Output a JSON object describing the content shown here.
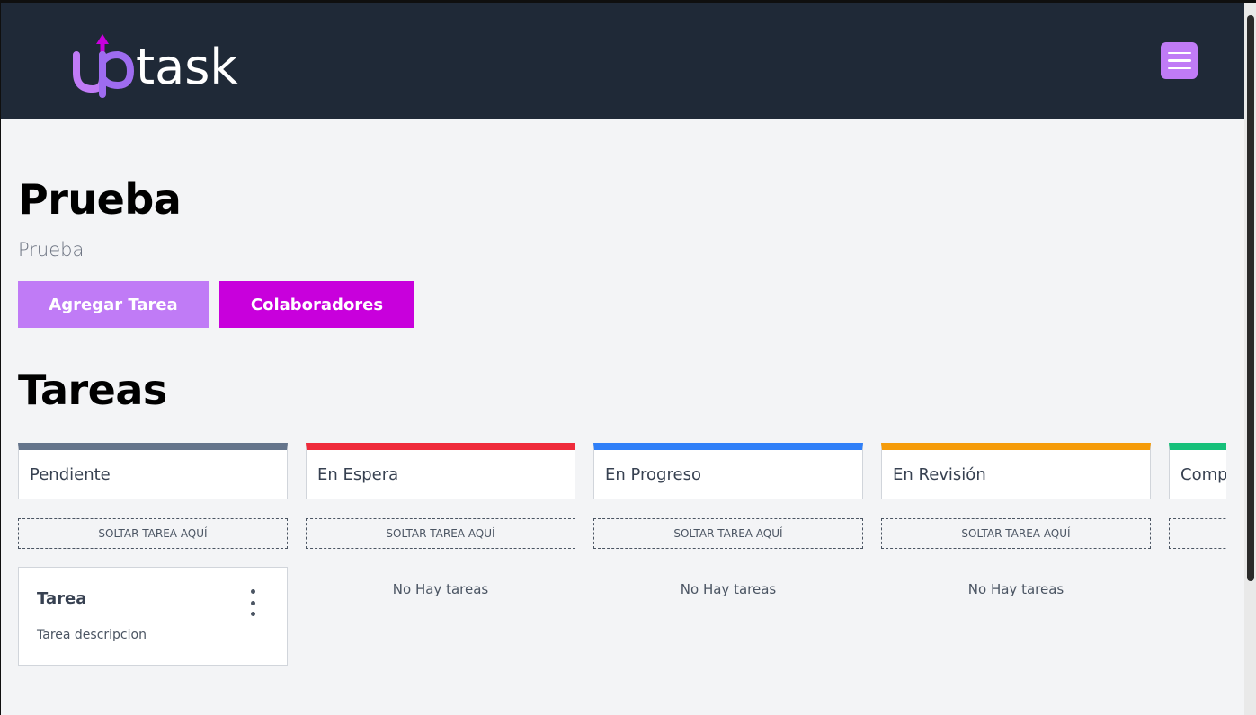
{
  "header": {
    "logo_text": "uptask",
    "menu_icon": "hamburger-icon",
    "colors": {
      "background": "#1f2937",
      "accent": "#c07bf6"
    }
  },
  "project": {
    "name": "Prueba",
    "description": "Prueba",
    "add_task_label": "Agregar Tarea",
    "collaborators_label": "Colaboradores"
  },
  "tasks_title": "Tareas",
  "columns": [
    {
      "label": "Pendiente",
      "color": "#64748b",
      "drop_label": "SOLTAR TAREA AQUÍ",
      "empty_label": ""
    },
    {
      "label": "En Espera",
      "color": "#ef2b3b",
      "drop_label": "SOLTAR TAREA AQUÍ",
      "empty_label": "No Hay tareas"
    },
    {
      "label": "En Progreso",
      "color": "#2f7ff8",
      "drop_label": "SOLTAR TAREA AQUÍ",
      "empty_label": "No Hay tareas"
    },
    {
      "label": "En Revisión",
      "color": "#f59b09",
      "drop_label": "SOLTAR TAREA AQUÍ",
      "empty_label": "No Hay tareas"
    },
    {
      "label": "Comp",
      "color": "#16c07a",
      "drop_label": "",
      "empty_label": ""
    }
  ],
  "task": {
    "title": "Tarea",
    "description": "Tarea descripcion",
    "menu_icon": "kebab-menu-icon"
  }
}
